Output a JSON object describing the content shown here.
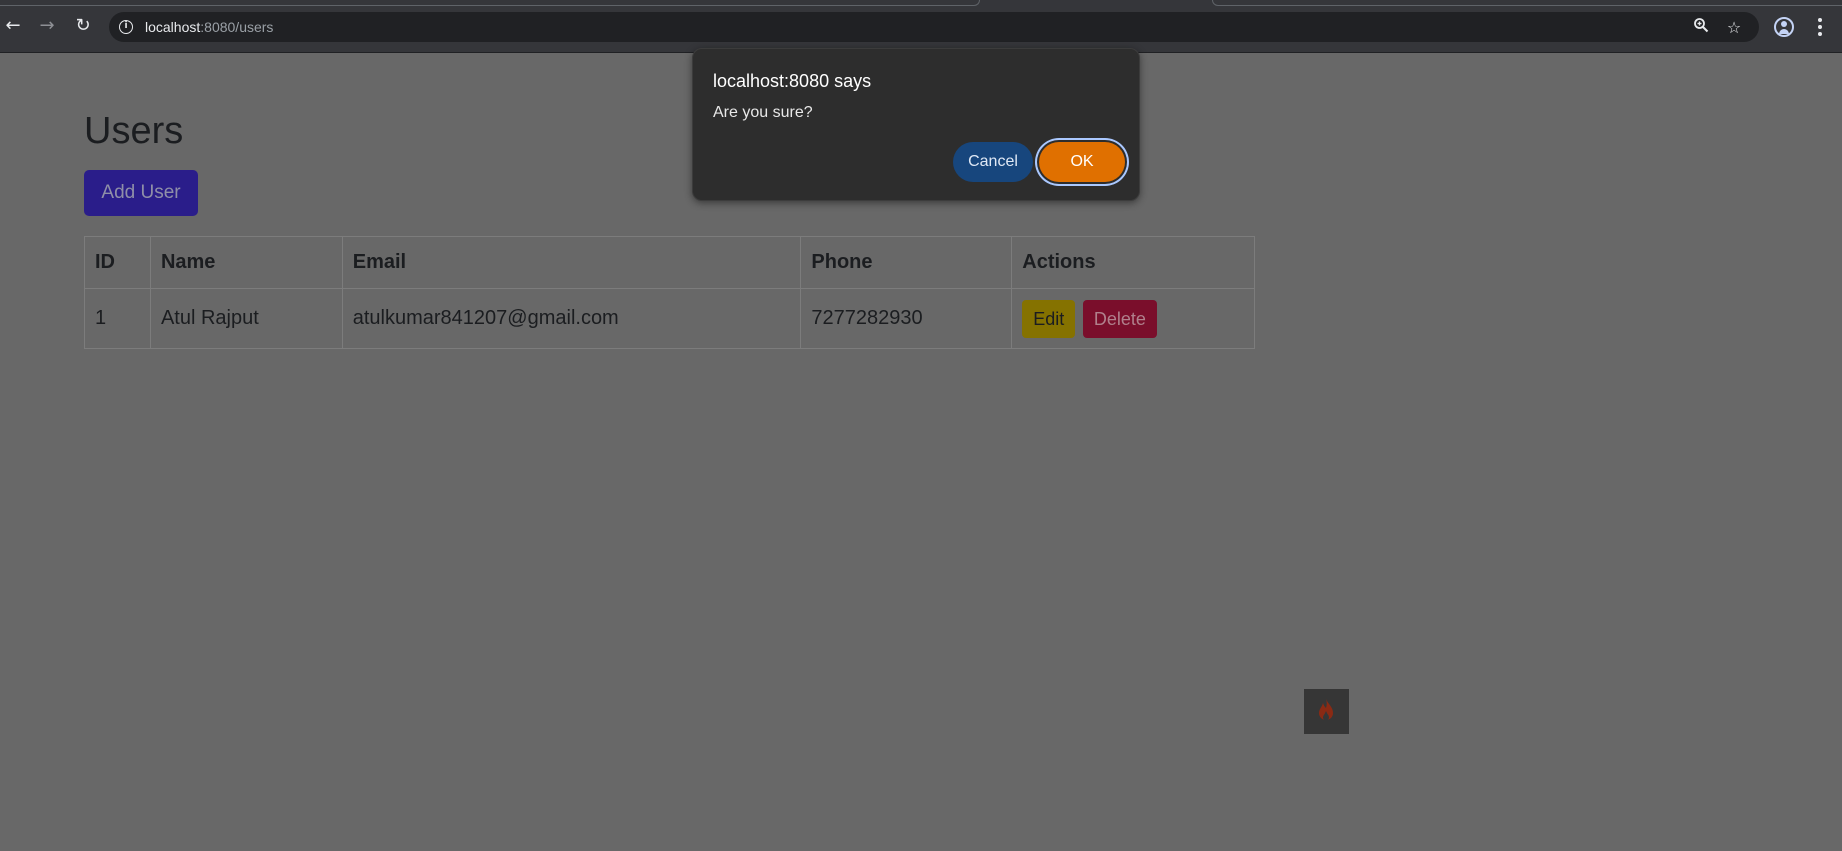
{
  "browser": {
    "url_host": "localhost",
    "url_rest": ":8080/users"
  },
  "page": {
    "title": "Users",
    "add_button_label": "Add User",
    "table": {
      "headers": [
        "ID",
        "Name",
        "Email",
        "Phone",
        "Actions"
      ],
      "rows": [
        {
          "id": "1",
          "name": "Atul Rajput",
          "email": "atulkumar841207@gmail.com",
          "phone": "7277282930",
          "edit_label": "Edit",
          "delete_label": "Delete"
        }
      ]
    }
  },
  "dialog": {
    "title": "localhost:8080 says",
    "message": "Are you sure?",
    "cancel_label": "Cancel",
    "ok_label": "OK"
  },
  "colors": {
    "overlay_bg": "#686868",
    "ok_button": "#e07000",
    "cancel_button": "#17467d",
    "add_button": "#2a1d8a",
    "edit_button": "#857200",
    "delete_button": "#7a0e2b"
  },
  "icons": {
    "back": "arrow-left-icon",
    "forward": "arrow-right-icon",
    "reload": "reload-icon",
    "site_info": "info-icon",
    "zoom": "zoom-icon",
    "bookmark": "star-icon",
    "profile": "profile-icon",
    "menu": "kebab-menu-icon",
    "extension": "fire-icon"
  }
}
